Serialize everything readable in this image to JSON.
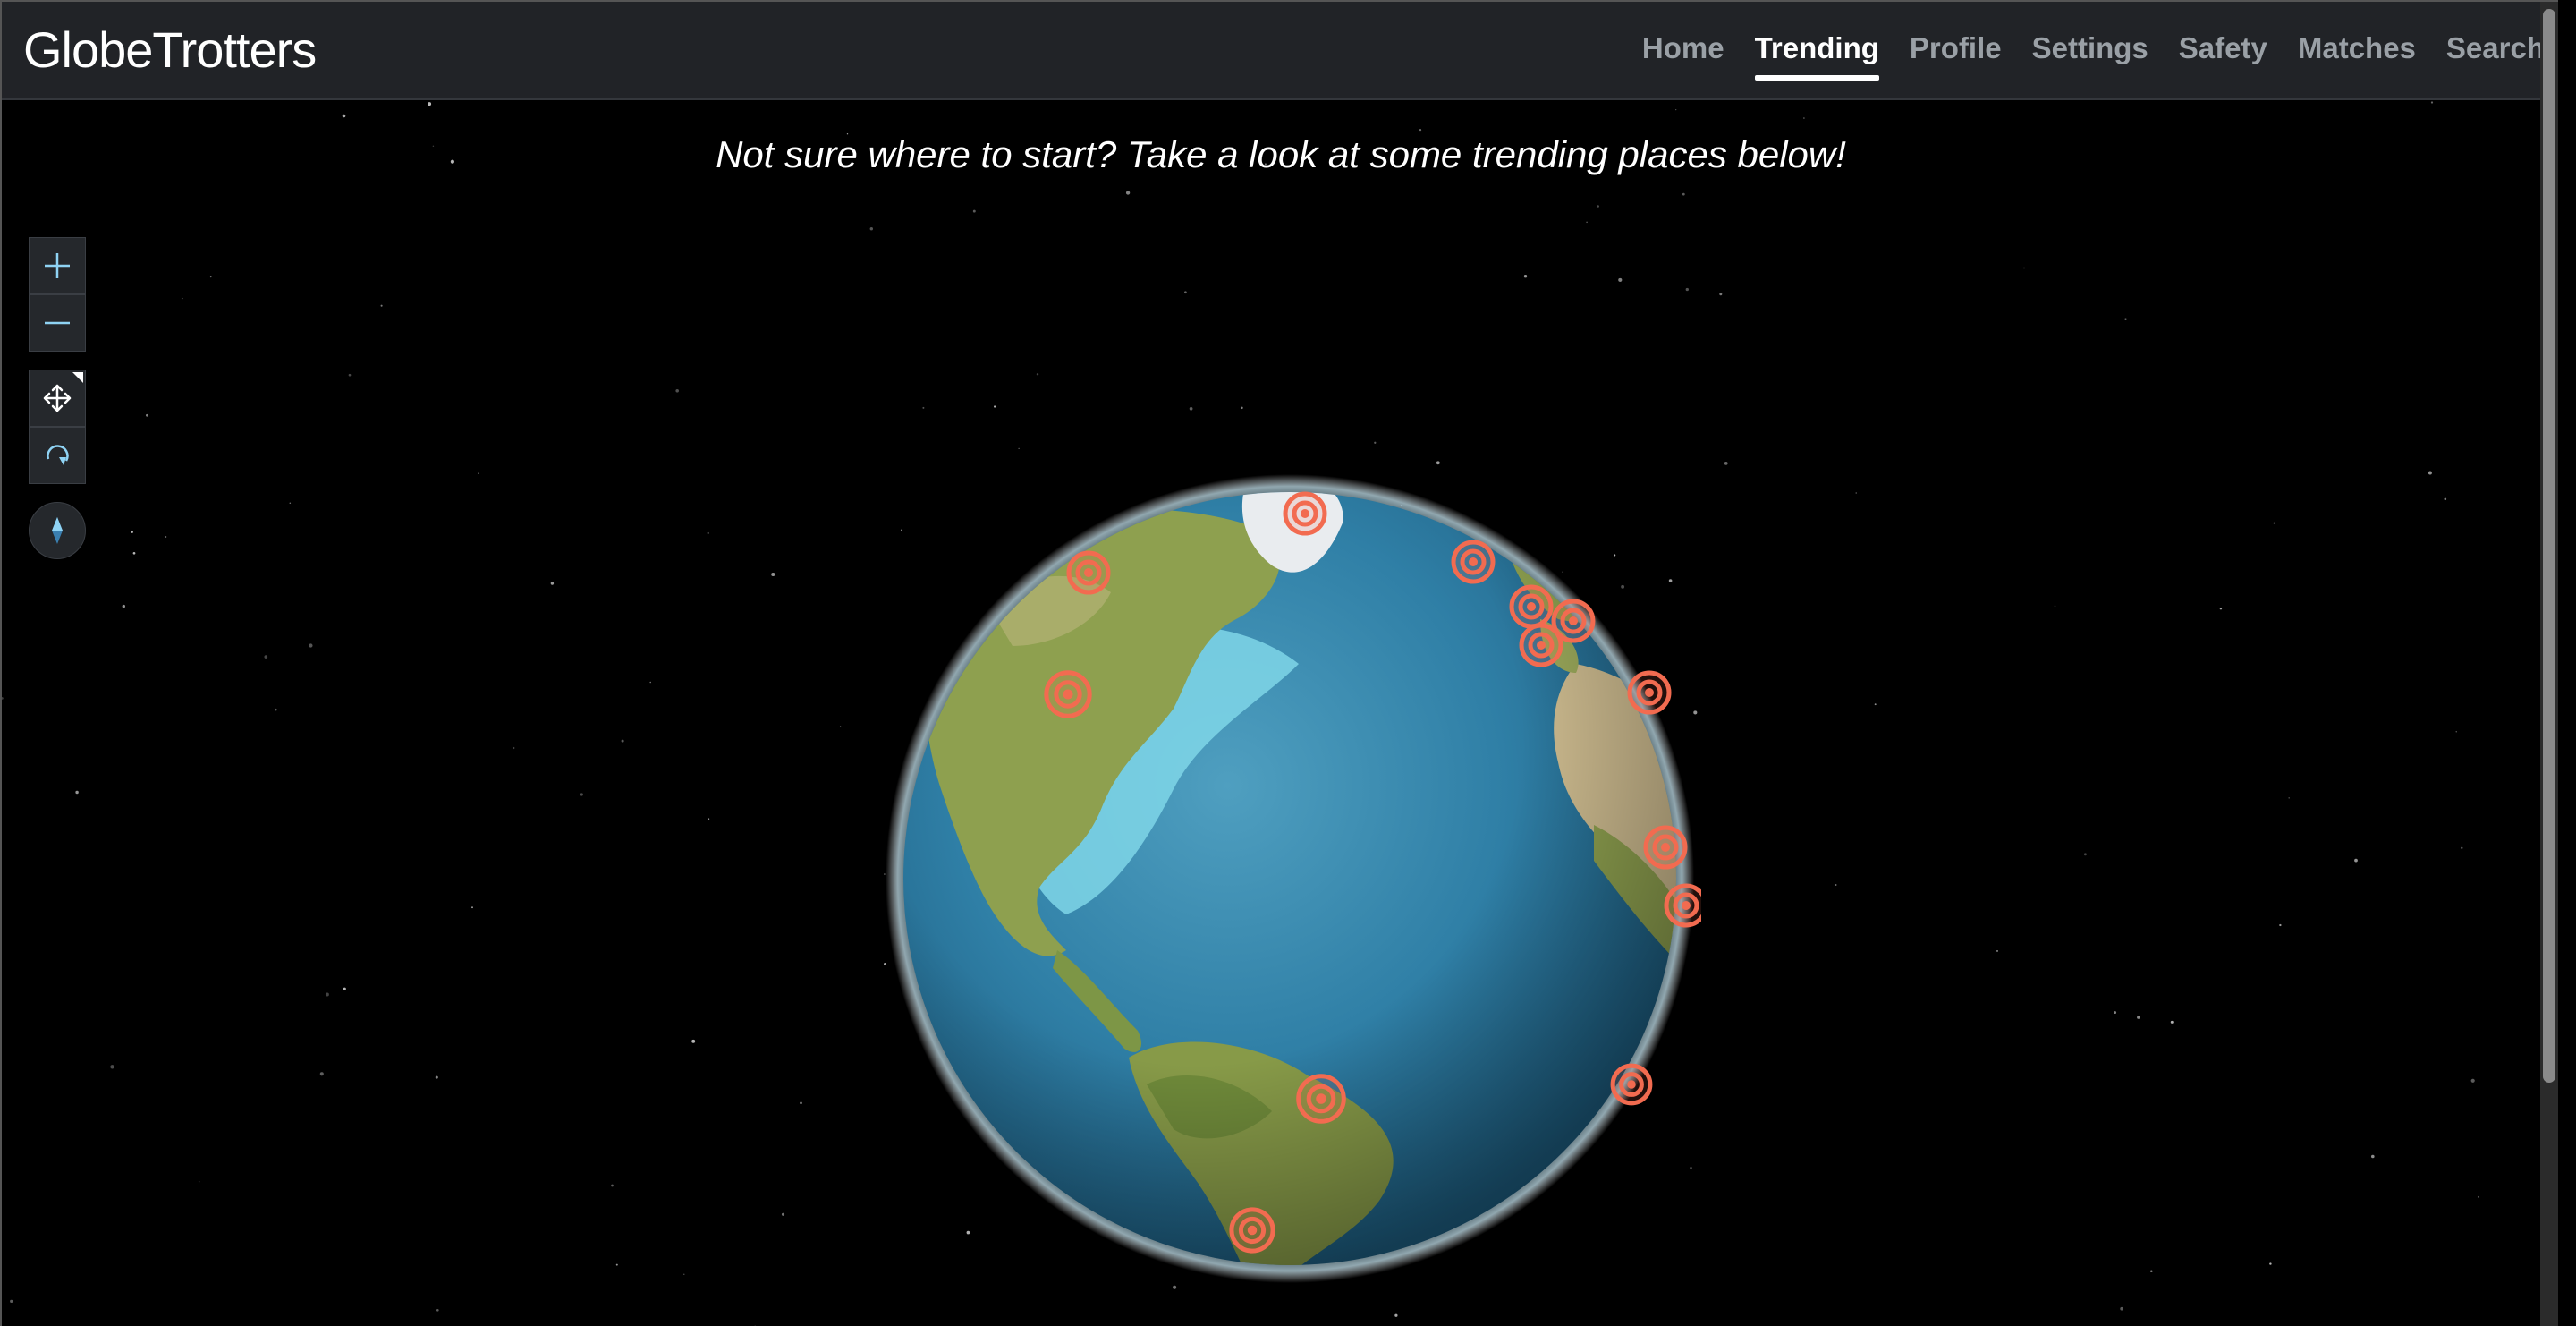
{
  "app": {
    "brand": "GlobeTrotters",
    "nav": [
      {
        "label": "Home",
        "active": false
      },
      {
        "label": "Trending",
        "active": true
      },
      {
        "label": "Profile",
        "active": false
      },
      {
        "label": "Settings",
        "active": false
      },
      {
        "label": "Safety",
        "active": false
      },
      {
        "label": "Matches",
        "active": false
      },
      {
        "label": "Search",
        "active": false
      }
    ]
  },
  "main": {
    "banner": "Not sure where to start? Take a look at some trending places below!"
  },
  "map_controls": {
    "zoom_in": "zoom-in-icon",
    "zoom_out": "zoom-out-icon",
    "pan": "pan-icon",
    "rotate": "rotate-icon",
    "compass": "compass-icon"
  },
  "colors": {
    "navbar": "#212327",
    "marker": "#f26b50",
    "ocean": "#2f7fa6",
    "land": "#8ea04f"
  }
}
